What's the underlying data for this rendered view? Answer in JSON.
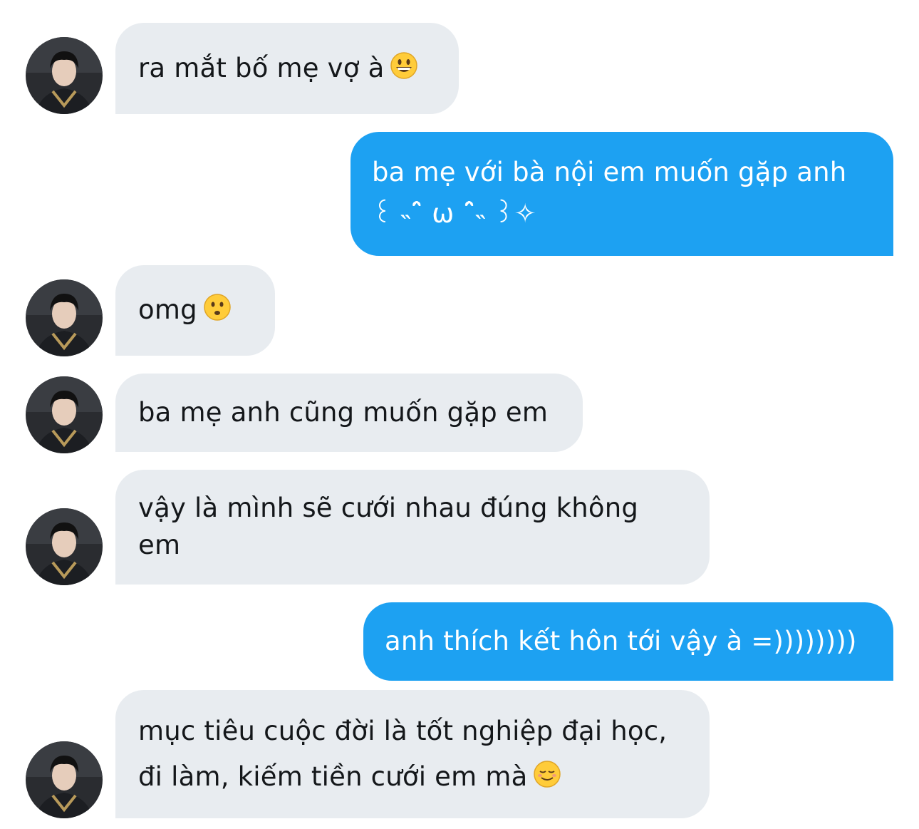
{
  "conversation": {
    "messages": [
      {
        "direction": "incoming",
        "text": "ra mắt bố mẹ vợ à",
        "emoji": "grinning-face-emoji"
      },
      {
        "direction": "outgoing",
        "text": "ba mẹ với bà nội em muốn gặp anh ꒰ ˵ˆ̑ ω ˆ̑˵ ꒱✧",
        "emoji": ""
      },
      {
        "direction": "incoming",
        "text": "omg",
        "emoji": "frowning-face-emoji"
      },
      {
        "direction": "incoming",
        "text": "ba mẹ anh cũng muốn gặp em",
        "emoji": ""
      },
      {
        "direction": "incoming",
        "text": "vậy là mình sẽ cưới nhau đúng không em",
        "emoji": ""
      },
      {
        "direction": "outgoing",
        "text": "anh thích kết hôn tới vậy à =))))))))",
        "emoji": ""
      },
      {
        "direction": "incoming",
        "text": "mục tiêu cuộc đời là tốt nghiệp đại học, đi làm, kiếm tiền cưới em mà",
        "emoji": "smiling-face-emoji"
      }
    ]
  },
  "colors": {
    "outgoing_bubble": "#1da1f2",
    "incoming_bubble": "#e8ecf0",
    "incoming_text": "#14171a",
    "outgoing_text": "#ffffff"
  }
}
